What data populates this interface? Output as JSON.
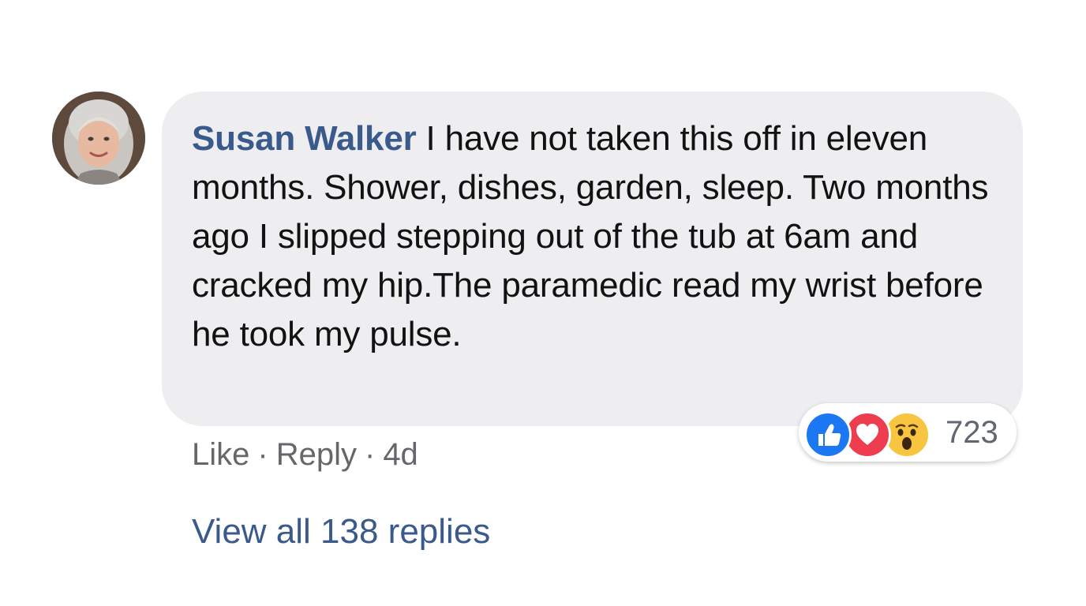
{
  "comment": {
    "author": "Susan Walker",
    "text": " I have not taken this off in eleven months. Shower, dishes, garden, sleep. Two months ago I slipped stepping out of the tub at 6am and cracked my hip.The paramedic read my wrist before he took my pulse.",
    "avatar_icon": "profile-photo"
  },
  "reactions": {
    "icons": [
      "thumbs-up-icon",
      "heart-icon",
      "wow-face-icon"
    ],
    "count": "723",
    "colors": {
      "like": "#1b77f2",
      "love": "#ee3d4f",
      "wow": "#f7c53f"
    }
  },
  "actions": {
    "like_label": "Like",
    "separator": "·",
    "reply_label": "Reply",
    "timestamp": "4d"
  },
  "replies": {
    "view_all_label": "View all 138 replies"
  },
  "colors": {
    "author_link": "#3b5a8c",
    "bubble_bg": "#eeeef1",
    "meta_text": "#65676b"
  }
}
